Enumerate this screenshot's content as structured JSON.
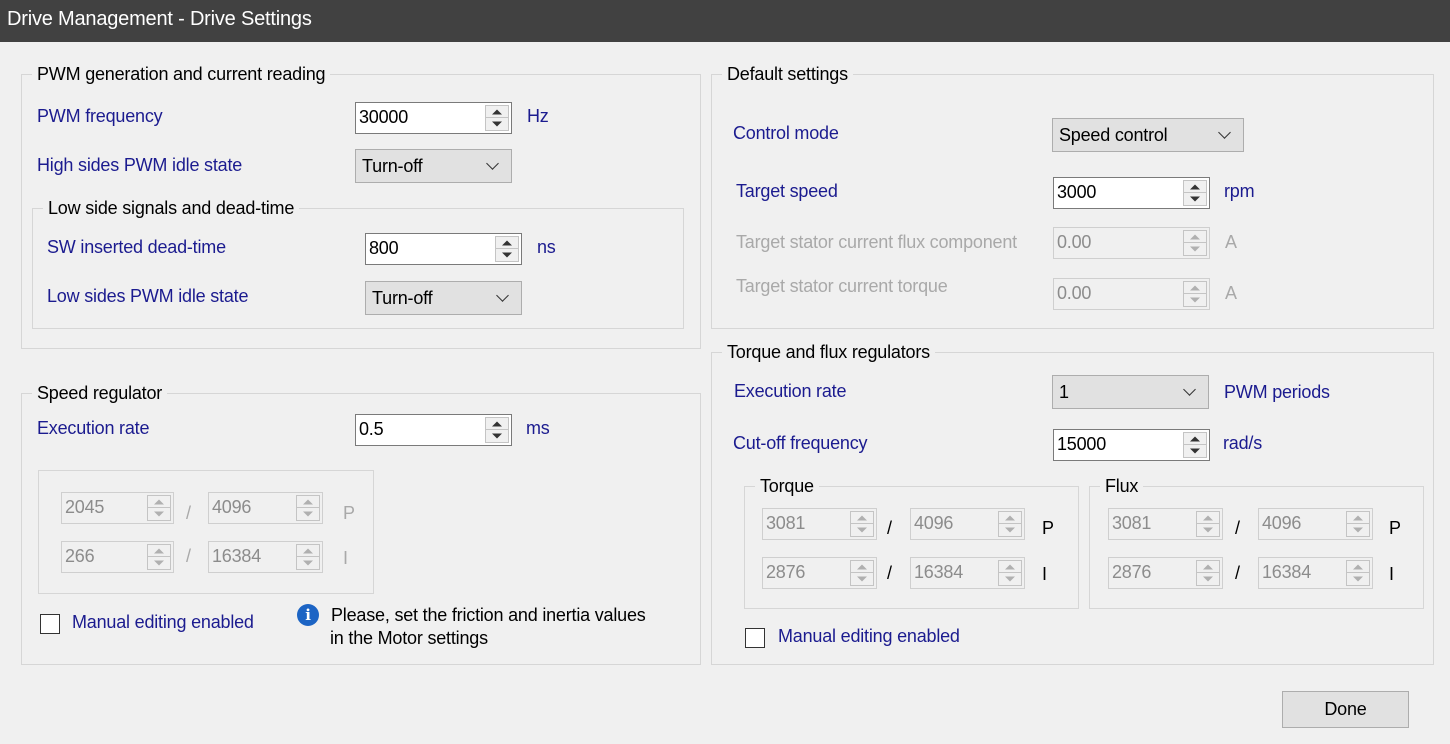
{
  "window": {
    "title": "Drive Management - Drive Settings"
  },
  "pwm_group": {
    "legend": "PWM generation and current reading",
    "frequency_label": "PWM frequency",
    "frequency_value": "30000",
    "frequency_unit": "Hz",
    "high_idle_label": "High sides PWM idle state",
    "high_idle_value": "Turn-off",
    "low_side": {
      "legend": "Low side signals and dead-time",
      "deadtime_label": "SW inserted dead-time",
      "deadtime_value": "800",
      "deadtime_unit": "ns",
      "low_idle_label": "Low sides PWM idle state",
      "low_idle_value": "Turn-off"
    }
  },
  "speed_group": {
    "legend": "Speed regulator",
    "exec_label": "Execution rate",
    "exec_value": "0.5",
    "exec_unit": "ms",
    "p_num": "2045",
    "p_den": "4096",
    "p_label": "P",
    "i_num": "266",
    "i_den": "16384",
    "i_label": "I",
    "slash": "/",
    "manual_label": "Manual editing enabled",
    "info_line1": "Please, set the friction and inertia values",
    "info_line2": "in the Motor settings"
  },
  "default_group": {
    "legend": "Default settings",
    "control_label": "Control mode",
    "control_value": "Speed control",
    "target_speed_label": "Target speed",
    "target_speed_value": "3000",
    "target_speed_unit": "rpm",
    "flux_label": "Target stator current flux component",
    "flux_value": "0.00",
    "flux_unit": "A",
    "torque_label": "Target stator current torque",
    "torque_value": "0.00",
    "torque_unit": "A"
  },
  "tf_group": {
    "legend": "Torque and flux regulators",
    "exec_label": "Execution rate",
    "exec_value": "1",
    "exec_unit": "PWM periods",
    "cutoff_label": "Cut-off frequency",
    "cutoff_value": "15000",
    "cutoff_unit": "rad/s",
    "torque": {
      "legend": "Torque",
      "p_num": "3081",
      "p_den": "4096",
      "p_label": "P",
      "i_num": "2876",
      "i_den": "16384",
      "i_label": "I"
    },
    "flux": {
      "legend": "Flux",
      "p_num": "3081",
      "p_den": "4096",
      "p_label": "P",
      "i_num": "2876",
      "i_den": "16384",
      "i_label": "I"
    },
    "slash": "/",
    "manual_label": "Manual editing enabled"
  },
  "done_button": {
    "label": "Done"
  }
}
